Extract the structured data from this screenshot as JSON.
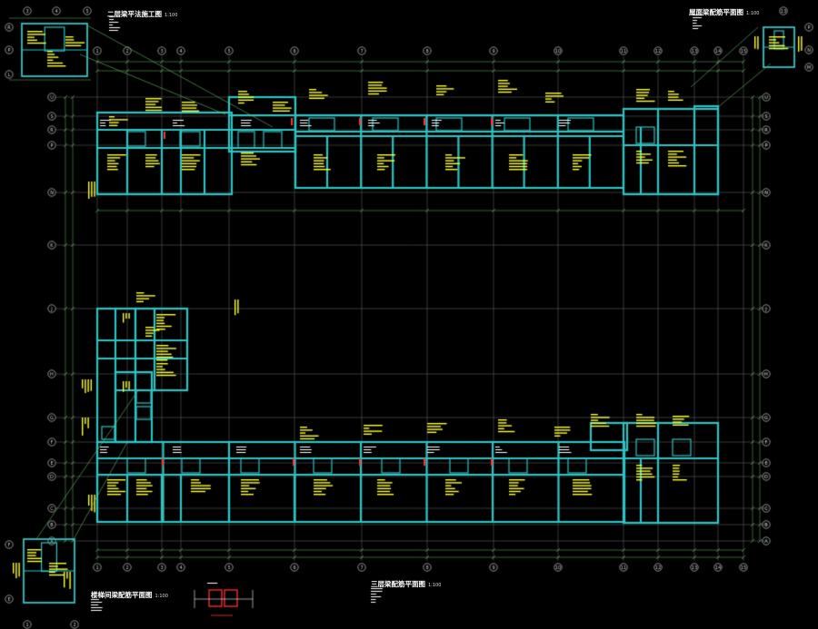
{
  "drawing": {
    "background": "#000000",
    "colors": {
      "grid_line": "#8a8a8a",
      "axis_line": "#7ccf7c",
      "dim_line": "#6fbf6f",
      "wall": "#2ec4c4",
      "wall_fill": "#0f4a4a",
      "beam_text": "#ffff33",
      "annotation": "#ffffff",
      "opening": "#ff3333",
      "bubble": "#cfcfcf"
    },
    "column_axes_top": [
      "1",
      "2",
      "3",
      "4",
      "5",
      "6",
      "7",
      "8",
      "9",
      "10",
      "11",
      "12",
      "13",
      "14",
      "15"
    ],
    "column_axes_bottom": [
      "1",
      "2",
      "3",
      "4",
      "5",
      "6",
      "7",
      "8",
      "9",
      "10",
      "11",
      "12",
      "13",
      "14",
      "15"
    ],
    "row_axes_left": [
      "U",
      "S",
      "R",
      "P",
      "N",
      "K",
      "J",
      "H",
      "G",
      "F",
      "E",
      "D",
      "C",
      "B",
      "A"
    ],
    "row_axes_right": [
      "U",
      "S",
      "R",
      "P",
      "N",
      "K",
      "J",
      "H",
      "G",
      "F",
      "E",
      "D",
      "C",
      "B",
      "A"
    ],
    "titles": [
      {
        "key": "plan_top_left",
        "text": "二层梁平法施工图",
        "scale": "1:100"
      },
      {
        "key": "plan_top_right",
        "text": "屋面梁配筋平面图",
        "scale": "1:100"
      },
      {
        "key": "plan_bottom_left",
        "text": "楼梯间梁配筋平面图",
        "scale": "1:100"
      },
      {
        "key": "plan_bottom_center",
        "text": "三层梁配筋平面图",
        "scale": "1:100"
      }
    ]
  }
}
